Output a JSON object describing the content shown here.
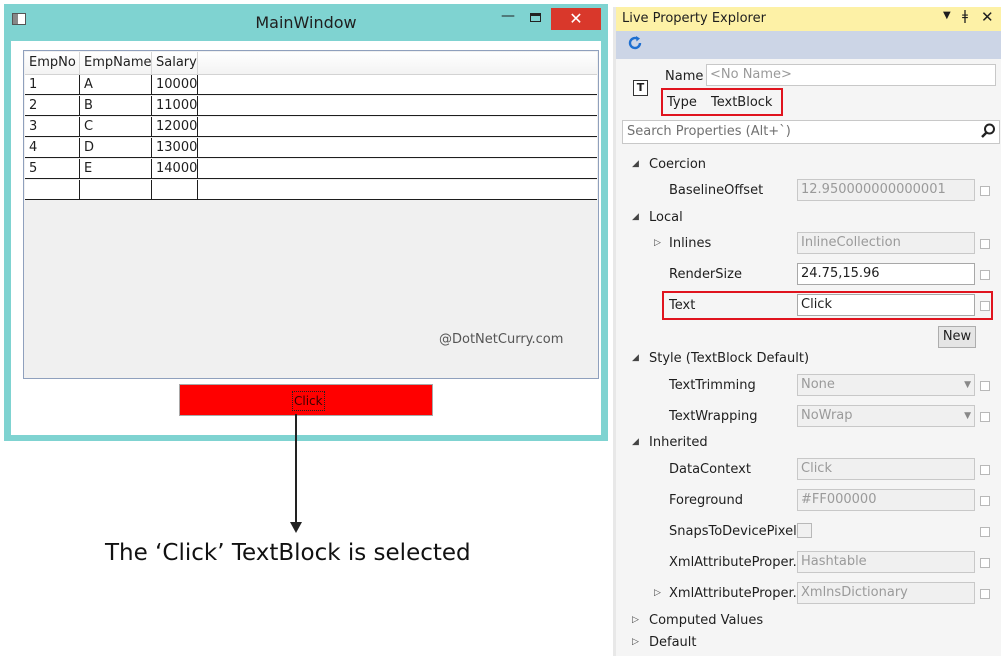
{
  "main_window": {
    "title": "MainWindow",
    "minimize_glyph": "—",
    "close_glyph": "✕",
    "grid": {
      "columns": [
        "EmpNo",
        "EmpName",
        "Salary"
      ],
      "rows": [
        [
          "1",
          "A",
          "10000"
        ],
        [
          "2",
          "B",
          "11000"
        ],
        [
          "3",
          "C",
          "12000"
        ],
        [
          "4",
          "D",
          "13000"
        ],
        [
          "5",
          "E",
          "14000"
        ]
      ]
    },
    "watermark": "@DotNetCurry.com",
    "button_text": "Click",
    "button_color": "#ff0000"
  },
  "annotation": {
    "caption": "The ‘Click’ TextBlock is selected"
  },
  "live_property_explorer": {
    "title": "Live Property Explorer",
    "titlebar_color": "#fdf1a6",
    "toolbar": {
      "refresh_icon": "refresh-icon"
    },
    "dropdown_glyph": "▼",
    "pin_glyph": "ǂ",
    "close_glyph": "✕",
    "name_label": "Name",
    "name_value": "<No Name>",
    "type_label": "Type",
    "type_value": "TextBlock",
    "type_icon_glyph": "T",
    "search_placeholder": "Search Properties (Alt+`)",
    "categories": {
      "coercion": "Coercion",
      "local": "Local",
      "style": "Style (TextBlock Default)",
      "inherited": "Inherited",
      "computed": "Computed Values",
      "default": "Default"
    },
    "props": {
      "baseline_offset": {
        "label": "BaselineOffset",
        "value": "12.950000000000001"
      },
      "inlines": {
        "label": "Inlines",
        "value": "InlineCollection"
      },
      "render_size": {
        "label": "RenderSize",
        "value": "24.75,15.96"
      },
      "text": {
        "label": "Text",
        "value": "Click"
      },
      "new_button": "New",
      "text_trimming": {
        "label": "TextTrimming",
        "value": "None"
      },
      "text_wrapping": {
        "label": "TextWrapping",
        "value": "NoWrap"
      },
      "data_context": {
        "label": "DataContext",
        "value": "Click"
      },
      "foreground": {
        "label": "Foreground",
        "value": "#FF000000"
      },
      "snaps": {
        "label": "SnapsToDevicePixels"
      },
      "xml_attr1": {
        "label": "XmlAttributeProper...",
        "value": "Hashtable"
      },
      "xml_attr2": {
        "label": "XmlAttributeProper...",
        "value": "XmlnsDictionary"
      }
    },
    "highlight_color": "#e0141e"
  }
}
